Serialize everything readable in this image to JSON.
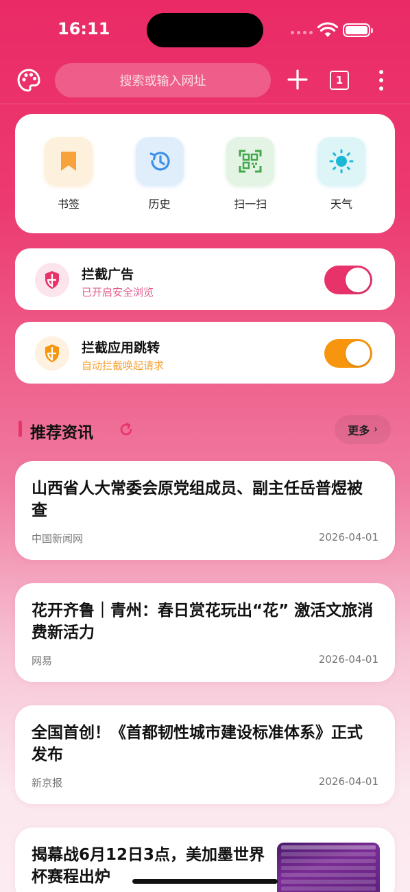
{
  "status_bar": {
    "time": "16:11"
  },
  "toolbar": {
    "search_placeholder": "搜索或输入网址",
    "tab_count": "1"
  },
  "quick_actions": [
    {
      "label": "书签",
      "icon": "bookmark-icon",
      "color": "#f7a23a"
    },
    {
      "label": "历史",
      "icon": "history-icon",
      "color": "#3d8fe8"
    },
    {
      "label": "扫一扫",
      "icon": "qr-scan-icon",
      "color": "#43a84c"
    },
    {
      "label": "天气",
      "icon": "sun-icon",
      "color": "#1ab8d6"
    }
  ],
  "toggles": [
    {
      "title": "拦截广告",
      "subtitle": "已开启安全浏览",
      "on": true,
      "color": "#e8336a"
    },
    {
      "title": "拦截应用跳转",
      "subtitle": "自动拦截唤起请求",
      "on": true,
      "color": "#f7950e"
    }
  ],
  "news_section": {
    "title": "推荐资讯",
    "more_label": "更多"
  },
  "news": [
    {
      "title": "山西省人大常委会原党组成员、副主任岳普煜被查",
      "source": "中国新闻网",
      "date": "2026-04-01"
    },
    {
      "title": "花开齐鲁｜青州：春日赏花玩出“花” 激活文旅消费新活力",
      "source": "网易",
      "date": "2026-04-01"
    },
    {
      "title": "全国首创！《首都韧性城市建设标准体系》正式发布",
      "source": "新京报",
      "date": "2026-04-01"
    },
    {
      "title": "揭幕战6月12日3点，美加墨世界杯赛程出炉"
    }
  ],
  "colors": {
    "brand": "#ea2a66",
    "accent_orange": "#f7950e"
  }
}
